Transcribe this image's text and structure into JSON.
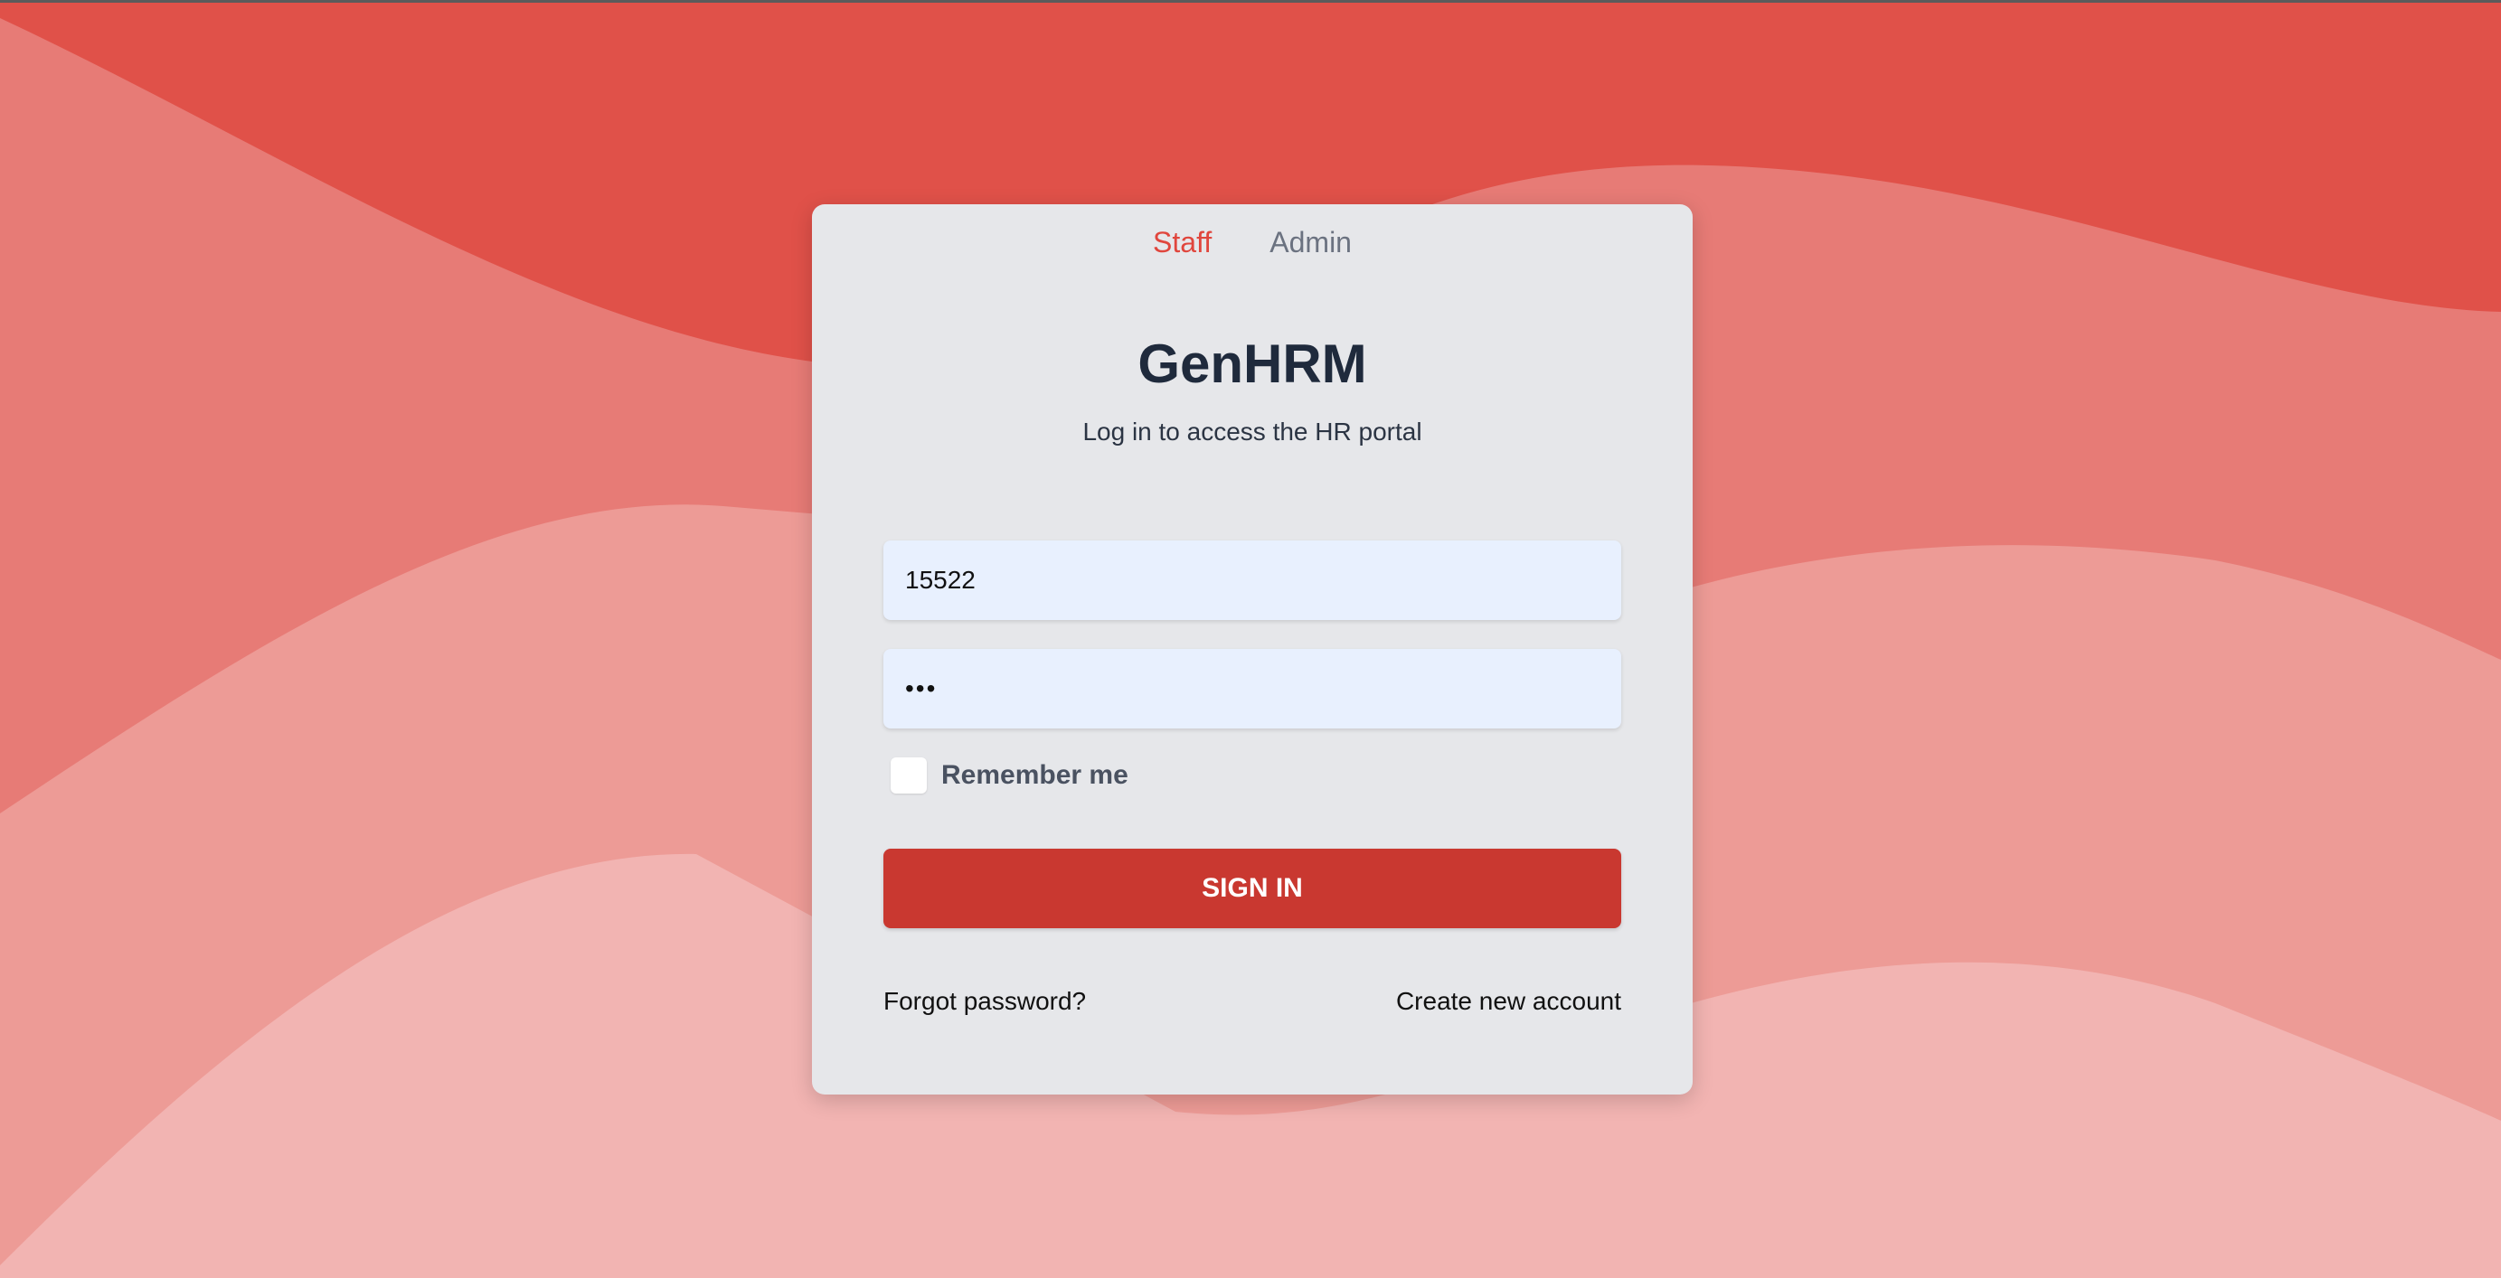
{
  "tabs": [
    {
      "label": "Staff",
      "active": true
    },
    {
      "label": "Admin",
      "active": false
    }
  ],
  "app": {
    "title": "GenHRM",
    "subtitle": "Log in to access the HR portal"
  },
  "form": {
    "username_value": "15522",
    "password_value": "•••",
    "remember_label": "Remember me",
    "remember_checked": false,
    "signin_label": "SIGN IN",
    "forgot_label": "Forgot password?",
    "create_label": "Create new account"
  },
  "colors": {
    "background": "#e05149",
    "accent": "#e0463d",
    "button": "#c93830",
    "card": "#e6e7ea",
    "input_bg": "#e8f0fe"
  }
}
